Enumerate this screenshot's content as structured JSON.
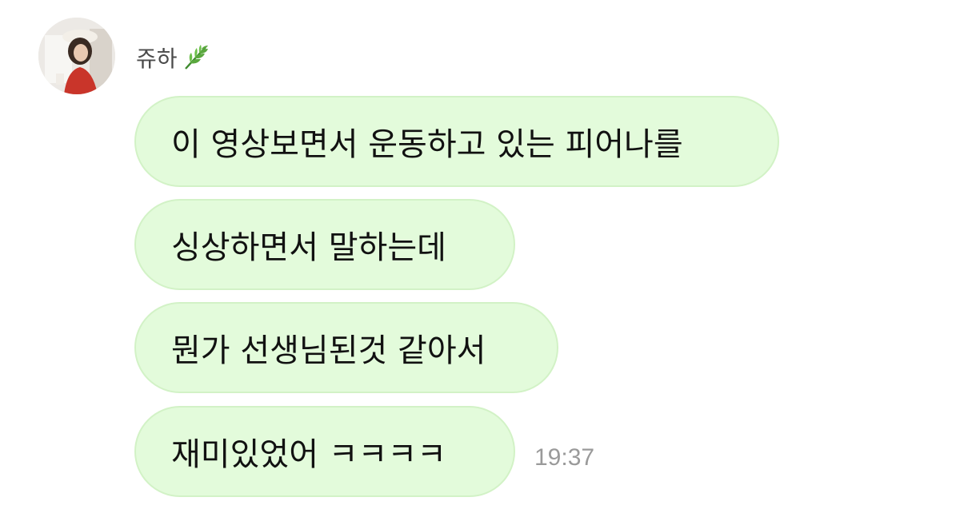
{
  "chat": {
    "sender": {
      "name": "쥬하",
      "emoji_icon": "herb-leaf-icon"
    },
    "messages": [
      {
        "text": "이 영상보면서 운동하고 있는 피어나를"
      },
      {
        "text": "싱상하면서 말하는데"
      },
      {
        "text": "뭔가 선생님된것 같아서"
      },
      {
        "text": "재미있었어 ㅋㅋㅋㅋ"
      }
    ],
    "timestamp": "19:37",
    "colors": {
      "bubble_bg": "#e3fbdb",
      "bubble_border": "#d2f2c6",
      "timestamp": "#9a9a9a",
      "sender_name": "#4a4a4a"
    }
  }
}
